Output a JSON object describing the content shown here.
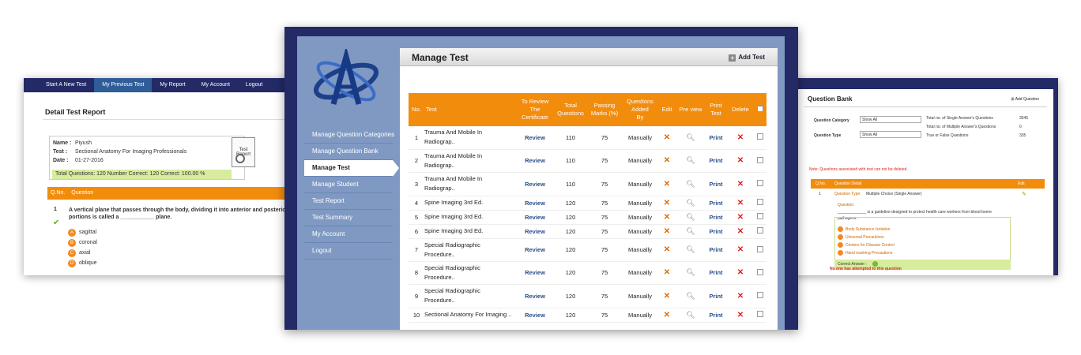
{
  "left_panel": {
    "nav": [
      "Start A New Test",
      "My Previous Test",
      "My Report",
      "My Account",
      "Logout"
    ],
    "title": "Detail Test Report",
    "name_label": "Name :",
    "name": "Piyush",
    "test_label": "Test :",
    "test": "Sectional Anatomy For Imaging Professionals",
    "date_label": "Date :",
    "date": "01-27-2016",
    "totals": "Total Questions: 120 Number Correct: 120 Correct: 100.00 %",
    "test_report_icon_label": "Test Report",
    "q_header": [
      "Q.No.",
      "Question"
    ],
    "question_no": "1",
    "question": "A vertical plane that passes through the body, dividing it into anterior and posterior portions is called a ___________ plane.",
    "options": [
      {
        "letter": "A",
        "text": "sagittal"
      },
      {
        "letter": "B",
        "text": "coronal"
      },
      {
        "letter": "C",
        "text": "axial"
      },
      {
        "letter": "D",
        "text": "oblique"
      }
    ]
  },
  "center_panel": {
    "menu": [
      "Manage Question Categories",
      "Manage Question Bank",
      "Manage Test",
      "Manage Student",
      "Test Report",
      "Test Summary",
      "My Account",
      "Logout"
    ],
    "active_menu": "Manage Test",
    "page_title": "Manage Test",
    "add_test": "Add Test",
    "columns": {
      "no": "No.",
      "test": "Test",
      "review1": "To Review",
      "review2": "The",
      "review3": "Certificate",
      "tq1": "Total",
      "tq2": "Questions",
      "pm1": "Passing",
      "pm2": "Marks (%)",
      "qa1": "Questions",
      "qa2": "Added",
      "qa3": "By",
      "edit": "Edit",
      "preview": "Pre view",
      "print1": "Print",
      "print2": "Test",
      "delete": "Delete"
    },
    "rows": [
      {
        "no": "1",
        "test1": "Trauma And Mobile In",
        "test2": "Radiograp..",
        "review": "Review",
        "total": "110",
        "pass": "75",
        "added": "Manually",
        "print": "Print"
      },
      {
        "no": "2",
        "test1": "Trauma And Mobile In",
        "test2": "Radiograp..",
        "review": "Review",
        "total": "110",
        "pass": "75",
        "added": "Manually",
        "print": "Print"
      },
      {
        "no": "3",
        "test1": "Trauma And Mobile In",
        "test2": "Radiograp..",
        "review": "Review",
        "total": "110",
        "pass": "75",
        "added": "Manually",
        "print": "Print"
      },
      {
        "no": "4",
        "test1": "Spine Imaging 3rd Ed.",
        "test2": "",
        "review": "Review",
        "total": "120",
        "pass": "75",
        "added": "Manually",
        "print": "Print"
      },
      {
        "no": "5",
        "test1": "Spine Imaging 3rd Ed.",
        "test2": "",
        "review": "Review",
        "total": "120",
        "pass": "75",
        "added": "Manually",
        "print": "Print"
      },
      {
        "no": "6",
        "test1": "Spine Imaging 3rd Ed.",
        "test2": "",
        "review": "Review",
        "total": "120",
        "pass": "75",
        "added": "Manually",
        "print": "Print"
      },
      {
        "no": "7",
        "test1": "Special Radiographic",
        "test2": "Procedure..",
        "review": "Review",
        "total": "120",
        "pass": "75",
        "added": "Manually",
        "print": "Print"
      },
      {
        "no": "8",
        "test1": "Special Radiographic",
        "test2": "Procedure..",
        "review": "Review",
        "total": "120",
        "pass": "75",
        "added": "Manually",
        "print": "Print"
      },
      {
        "no": "9",
        "test1": "Special Radiographic",
        "test2": "Procedure..",
        "review": "Review",
        "total": "120",
        "pass": "75",
        "added": "Manually",
        "print": "Print"
      },
      {
        "no": "10",
        "test1": "Sectional Anatomy For Imaging ..",
        "test2": "",
        "review": "Review",
        "total": "120",
        "pass": "75",
        "added": "Manually",
        "print": "Print"
      }
    ],
    "colors": {
      "frame": "#232a66",
      "sidebar": "#7f99c3",
      "accent": "#f28c0c"
    }
  },
  "right_panel": {
    "title": "Question Bank",
    "add_question": "Add Question",
    "category_label": "Question Category",
    "category_value": "Show All",
    "type_label": "Question Type",
    "type_value": "Show All",
    "stat1": "Total no. of Single Answer's Questions",
    "stat1_val": "3545",
    "stat2": "Total no. of Multiple Answer's Questions",
    "stat2_val": "0",
    "stat3": "True or False Questions",
    "stat3_val": "335",
    "note": "Note: Questions associated with test can not be deleted.",
    "col_no": "Q.No.",
    "col_detail": "Question Detail",
    "col_edit": "Edit",
    "qno": "1",
    "qtype_label": "Question Type:",
    "qtype": "Multiple Choice (Single Answer)",
    "question_label": "Question:",
    "question": "_____________ is a guideline designed to protect health care workers from blood borne pathogens.",
    "options": [
      "Body Substance Isolation",
      "Universal Precautions",
      "Centers for Disease Control",
      "Hand washing Precautions"
    ],
    "correct_label": "Correct Answer :",
    "no_attempt": "No one has attempted to this question"
  }
}
